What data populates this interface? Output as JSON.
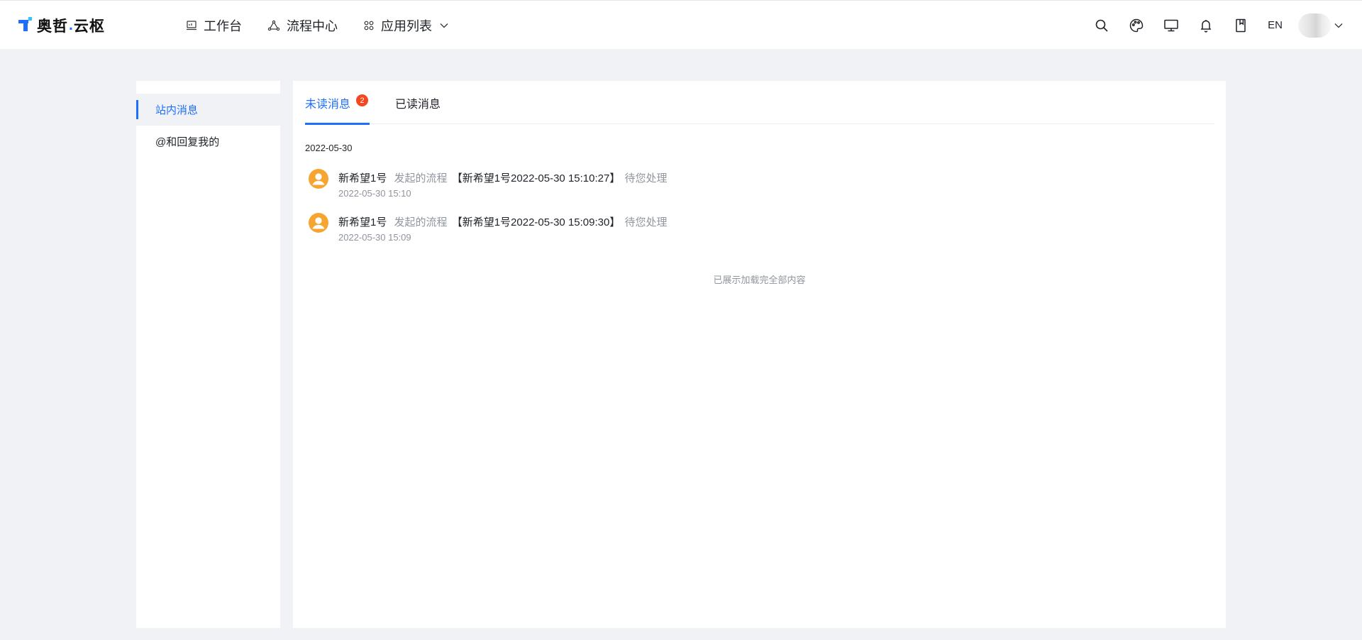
{
  "header": {
    "logo_text_a": "奥哲",
    "logo_dot": ".",
    "logo_text_b": "云枢",
    "nav": [
      {
        "label": "工作台",
        "icon": "workbench-icon"
      },
      {
        "label": "流程中心",
        "icon": "flow-icon"
      },
      {
        "label": "应用列表",
        "icon": "apps-icon"
      }
    ],
    "lang": "EN",
    "tool_icons": [
      "search-icon",
      "palette-icon",
      "monitor-icon",
      "bell-icon",
      "book-icon"
    ]
  },
  "sidebar": {
    "items": [
      {
        "label": "站内消息",
        "active": true
      },
      {
        "label": "@和回复我的",
        "active": false
      }
    ]
  },
  "tabs": [
    {
      "label": "未读消息",
      "badge": "2",
      "active": true
    },
    {
      "label": "已读消息",
      "active": false
    }
  ],
  "messages": {
    "group_date": "2022-05-30",
    "items": [
      {
        "user": "新希望1号",
        "action": "发起的流程",
        "title": "【新希望1号2022-05-30 15:10:27】",
        "status": "待您处理",
        "time": "2022-05-30 15:10"
      },
      {
        "user": "新希望1号",
        "action": "发起的流程",
        "title": "【新希望1号2022-05-30 15:09:30】",
        "status": "待您处理",
        "time": "2022-05-30 15:09"
      }
    ],
    "end_text": "已展示加载完全部内容"
  },
  "colors": {
    "accent": "#1e6fff",
    "badge": "#f5471f",
    "avatar": "#f7a531",
    "background": "#f0f2f5"
  }
}
